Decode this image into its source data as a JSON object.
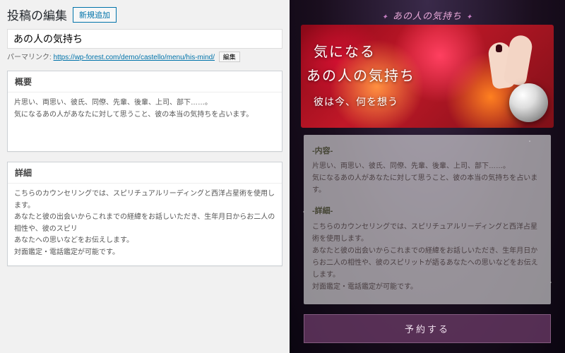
{
  "left": {
    "header": "投稿の編集",
    "addNew": "新規追加",
    "titleValue": "あの人の気持ち",
    "permalinkLabel": "パーマリンク:",
    "permalinkUrl": "https://wp-forest.com/demo/castello/menu/his-mind/",
    "editBtn": "編集",
    "box1": {
      "title": "概要",
      "body": "片思い、両思い、彼氏、同僚、先輩、後輩、上司、部下……。\n気になるあの人があなたに対して思うこと、彼の本当の気持ちを占います。"
    },
    "box2": {
      "title": "詳細",
      "body": "こちらのカウンセリングでは、スピリチュアルリーディングと西洋占星術を使用します。\nあなたと彼の出会いからこれまでの経緯をお話しいただき、生年月日からお二人の相性や、彼のスピリ\nあなたへの思いなどをお伝えします。\n対面鑑定・電話鑑定が可能です。"
    }
  },
  "right": {
    "pageTag": "あの人の気持ち",
    "hero": {
      "line1": "気になる",
      "line2": "あの人の気持ち",
      "line3": "彼は今、何を想う"
    },
    "section1": {
      "title": "-内容-",
      "body": "片思い、両思い、彼氏、同僚、先輩、後輩、上司、部下……。\n気になるあの人があなたに対して思うこと、彼の本当の気持ちを占います。"
    },
    "section2": {
      "title": "-詳細-",
      "body": "こちらのカウンセリングでは、スピリチュアルリーディングと西洋占星術を使用します。\nあなたと彼の出会いからこれまでの経緯をお話しいただき、生年月日からお二人の相性や、彼のスピリットが語るあなたへの思いなどをお伝えします。\n対面鑑定・電話鑑定が可能です。"
    },
    "cta": "予約する"
  }
}
